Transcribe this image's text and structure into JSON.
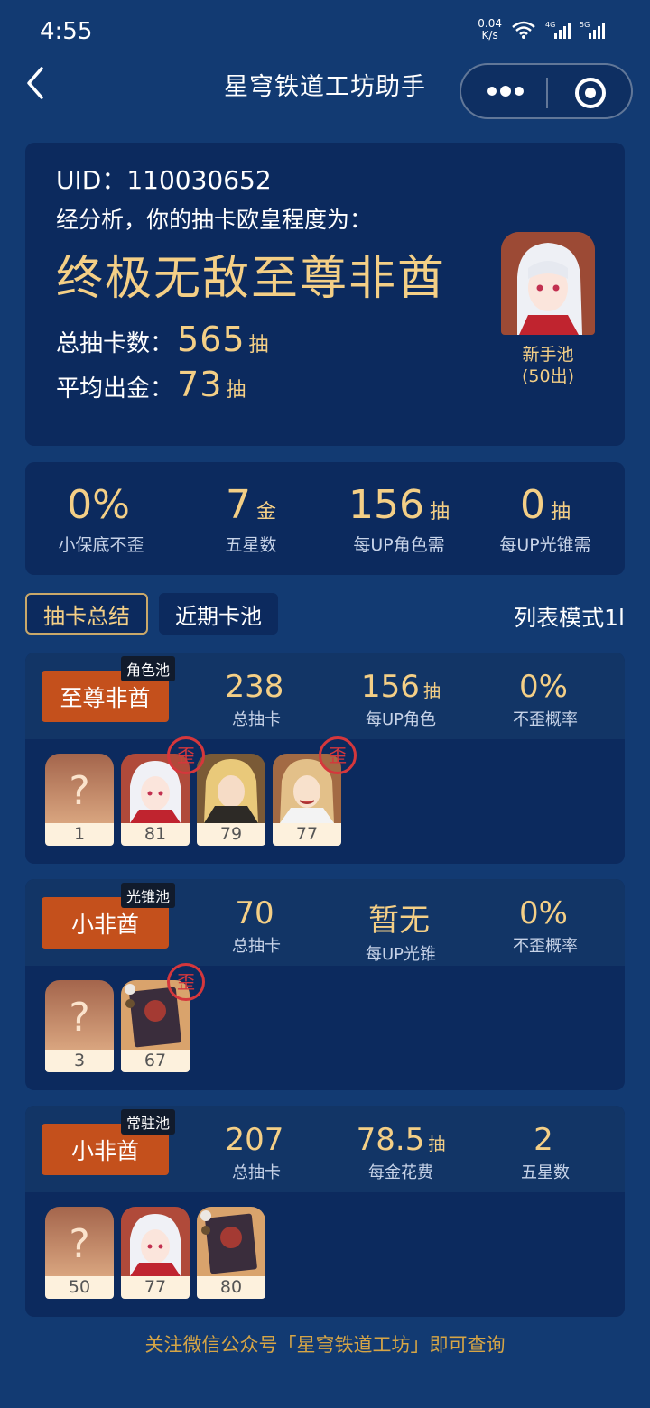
{
  "status_bar": {
    "time": "4:55",
    "speed_value": "0.04",
    "speed_unit": "K/s",
    "net1": "4G",
    "net2": "5G"
  },
  "nav": {
    "title": "星穹铁道工坊助手"
  },
  "summary": {
    "uid": "UID：110030652",
    "analysis": "经分析，你的抽卡欧皇程度为：",
    "rank": "终极无敌至尊非酋",
    "total_label": "总抽卡数：",
    "total_value": "565",
    "total_unit": "抽",
    "avg_label": "平均出金：",
    "avg_value": "73",
    "avg_unit": "抽",
    "pool_caption_1": "新手池",
    "pool_caption_2": "(50出)"
  },
  "stats": [
    {
      "value": "0%",
      "unit": "",
      "label": "小保底不歪"
    },
    {
      "value": "7",
      "unit": "金",
      "label": "五星数"
    },
    {
      "value": "156",
      "unit": "抽",
      "label": "每UP角色需"
    },
    {
      "value": "0",
      "unit": "抽",
      "label": "每UP光锥需"
    }
  ],
  "tabs": {
    "active": "抽卡总结",
    "other": "近期卡池",
    "list_mode": "列表模式1l"
  },
  "pools": [
    {
      "tag": "角色池",
      "rank": "至尊非酋",
      "m1_value": "238",
      "m1_unit": "",
      "m1_label": "总抽卡",
      "m2_value": "156",
      "m2_unit": "抽",
      "m2_label": "每UP角色",
      "m3_value": "0%",
      "m3_unit": "",
      "m3_label": "不歪概率",
      "items": [
        "1",
        "81",
        "79",
        "77"
      ],
      "wai": "歪"
    },
    {
      "tag": "光锥池",
      "rank": "小非酋",
      "m1_value": "70",
      "m1_unit": "",
      "m1_label": "总抽卡",
      "m2_value": "暂无",
      "m2_unit": "",
      "m2_label": "每UP光锥",
      "m3_value": "0%",
      "m3_unit": "",
      "m3_label": "不歪概率",
      "items": [
        "3",
        "67"
      ],
      "wai": "歪"
    },
    {
      "tag": "常驻池",
      "rank": "小非酋",
      "m1_value": "207",
      "m1_unit": "",
      "m1_label": "总抽卡",
      "m2_value": "78.5",
      "m2_unit": "抽",
      "m2_label": "每金花费",
      "m3_value": "2",
      "m3_unit": "",
      "m3_label": "五星数",
      "items": [
        "50",
        "77",
        "80"
      ]
    }
  ],
  "question_mark": "?",
  "footer": "关注微信公众号「星穹铁道工坊」即可查询",
  "colors": {
    "background": "#123a72",
    "card": "#0c2a5e",
    "gold": "#f4cf86",
    "rank_button": "#c4501c",
    "wai_ring": "#d5373c"
  }
}
